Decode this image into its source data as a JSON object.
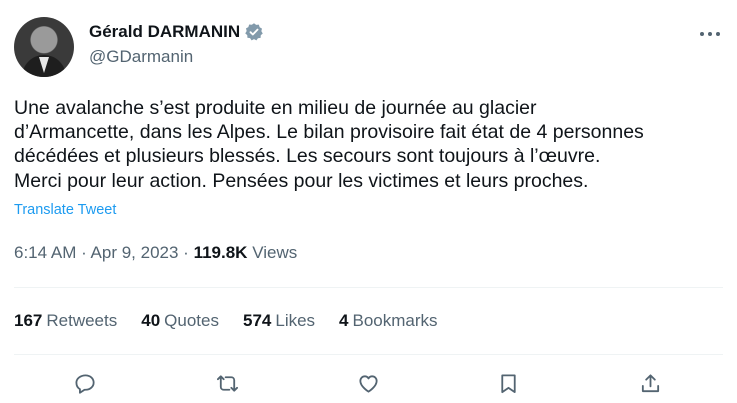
{
  "author": {
    "name": "Gérald DARMANIN",
    "handle": "@GDarmanin",
    "verified_icon": "verified-badge-icon",
    "avatar_icon": "avatar"
  },
  "tweet": {
    "text": "Une avalanche s’est produite en milieu de journée au glacier\nd’Armancette, dans les Alpes. Le bilan provisoire fait état de 4 personnes\ndécédées et plusieurs blessés. Les secours sont toujours à l’œuvre.\nMerci pour leur action. Pensées pour les victimes et leurs proches.",
    "translate_label": "Translate Tweet",
    "time": "6:14 AM",
    "separator": " · ",
    "date": "Apr 9, 2023",
    "views_count": "119.8K",
    "views_label": "Views"
  },
  "stats": {
    "retweets": {
      "count": "167",
      "label": "Retweets"
    },
    "quotes": {
      "count": "40",
      "label": "Quotes"
    },
    "likes": {
      "count": "574",
      "label": "Likes"
    },
    "bookmarks": {
      "count": "4",
      "label": "Bookmarks"
    }
  },
  "actions": [
    "reply-icon",
    "retweet-icon",
    "like-icon",
    "bookmark-icon",
    "share-icon"
  ],
  "colors": {
    "text": "#0f1419",
    "secondary": "#536471",
    "link": "#1d9bf0",
    "verified": "#829aab",
    "divider": "#eff3f4"
  }
}
